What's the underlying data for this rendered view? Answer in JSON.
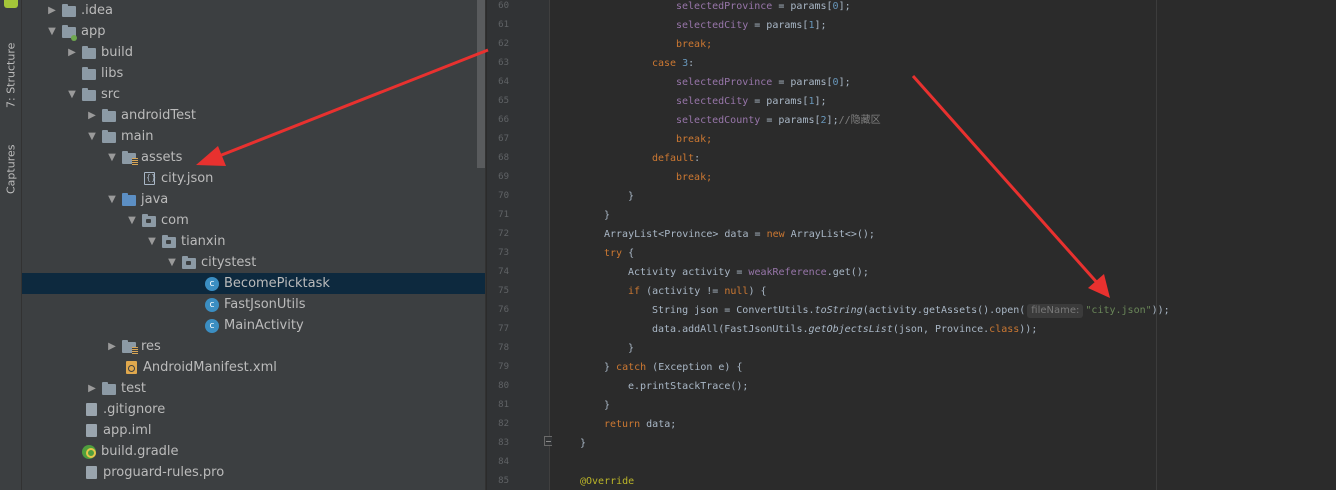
{
  "stripe": {
    "tabs": [
      "7: Structure",
      "Captures"
    ]
  },
  "tree": {
    "rows": [
      {
        "label": ".idea",
        "kind": "folder"
      },
      {
        "label": "app",
        "kind": "module"
      },
      {
        "label": "build",
        "kind": "folder"
      },
      {
        "label": "libs",
        "kind": "folder"
      },
      {
        "label": "src",
        "kind": "folder"
      },
      {
        "label": "androidTest",
        "kind": "folder"
      },
      {
        "label": "main",
        "kind": "folder"
      },
      {
        "label": "assets",
        "kind": "resource-folder"
      },
      {
        "label": "city.json",
        "kind": "json-file"
      },
      {
        "label": "java",
        "kind": "source-folder"
      },
      {
        "label": "com",
        "kind": "package"
      },
      {
        "label": "tianxin",
        "kind": "package"
      },
      {
        "label": "citystest",
        "kind": "package"
      },
      {
        "label": "BecomePicktask",
        "kind": "class",
        "selected": true
      },
      {
        "label": "FastJsonUtils",
        "kind": "class"
      },
      {
        "label": "MainActivity",
        "kind": "class"
      },
      {
        "label": "res",
        "kind": "resource-folder"
      },
      {
        "label": "AndroidManifest.xml",
        "kind": "xml-file"
      },
      {
        "label": "test",
        "kind": "folder"
      },
      {
        "label": ".gitignore",
        "kind": "text-file"
      },
      {
        "label": "app.iml",
        "kind": "text-file"
      },
      {
        "label": "build.gradle",
        "kind": "gradle-file"
      },
      {
        "label": "proguard-rules.pro",
        "kind": "text-file"
      }
    ]
  },
  "editor": {
    "line_numbers": [
      "60",
      "61",
      "62",
      "63",
      "64",
      "65",
      "66",
      "67",
      "68",
      "69",
      "70",
      "71",
      "72",
      "73",
      "74",
      "75",
      "76",
      "77",
      "78",
      "79",
      "80",
      "81",
      "82",
      "83",
      "84",
      "85"
    ],
    "lines": {
      "l60": {
        "a": "selectedProvince",
        "b": " = params[",
        "c": "0",
        "d": "];"
      },
      "l61": {
        "a": "selectedCity",
        "b": " = params[",
        "c": "1",
        "d": "];"
      },
      "l62": {
        "a": "break",
        "b": ";"
      },
      "l63": {
        "a": "case ",
        "b": "3",
        "c": ":"
      },
      "l64": {
        "a": "selectedProvince",
        "b": " = params[",
        "c": "0",
        "d": "];"
      },
      "l65": {
        "a": "selectedCity",
        "b": " = params[",
        "c": "1",
        "d": "];"
      },
      "l66": {
        "a": "selectedCounty",
        "b": " = params[",
        "c": "2",
        "d": "];",
        "e": "//隐藏区"
      },
      "l67": {
        "a": "break",
        "b": ";"
      },
      "l68": {
        "a": "default",
        "b": ":"
      },
      "l69": {
        "a": "break",
        "b": ";"
      },
      "l70": {
        "a": "}"
      },
      "l71": {
        "a": "}"
      },
      "l72": {
        "a": "ArrayList<Province> data = ",
        "b": "new ",
        "c": "ArrayList<>();"
      },
      "l73": {
        "a": "try ",
        "b": "{"
      },
      "l74": {
        "a": "Activity activity = ",
        "b": "weakReference",
        "c": ".get();"
      },
      "l75": {
        "a": "if ",
        "b": "(activity != ",
        "c": "null",
        "d": ") {"
      },
      "l76": {
        "a": "String json = ConvertUtils.",
        "b": "toString",
        "c": "(activity.getAssets().open(",
        "hint": "fileName:",
        "d": "\"city.json\"",
        "e": "));"
      },
      "l77": {
        "a": "data.addAll(FastJsonUtils.",
        "b": "getObjectsList",
        "c": "(json, Province.",
        "d": "class",
        "e": "));"
      },
      "l78": {
        "a": "}"
      },
      "l79": {
        "a": "} ",
        "b": "catch ",
        "c": "(Exception e) {"
      },
      "l80": {
        "a": "e.printStackTrace();"
      },
      "l81": {
        "a": "}"
      },
      "l82": {
        "a": "return ",
        "b": "data;"
      },
      "l83": {
        "a": "}"
      },
      "l84": {
        "a": ""
      },
      "l85": {
        "a": "@Override"
      }
    }
  },
  "colors": {
    "annotation_arrow": "#e8312f",
    "selection": "#0d293e",
    "keyword": "#cc7832",
    "field": "#9876aa",
    "string": "#6a8759",
    "number": "#6897bb"
  }
}
